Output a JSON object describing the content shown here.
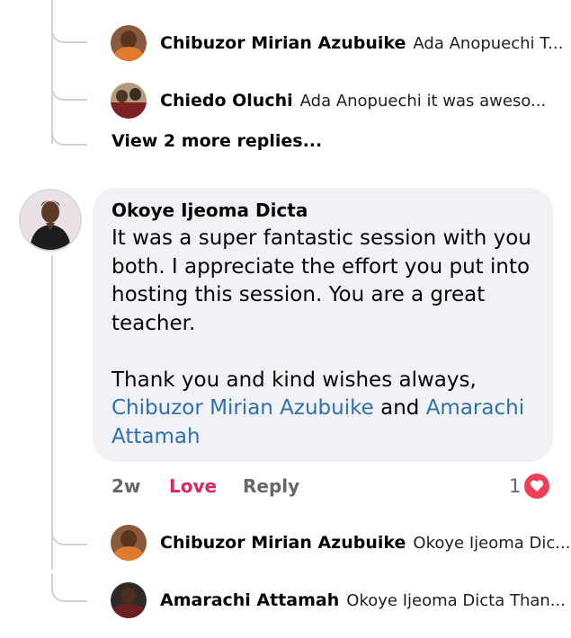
{
  "top_replies": [
    {
      "name": "Chibuzor Mirian Azubuike",
      "preview": "Ada Anopuechi T..."
    },
    {
      "name": "Chiedo Oluchi",
      "preview": "Ada Anopuechi it was aweso..."
    }
  ],
  "view_more": "View 2 more replies...",
  "comment": {
    "author": "Okoye Ijeoma Dicta",
    "paragraph1": "It was a super fantastic session with you both. I appreciate the effort you put into hosting this session. You are a great teacher.",
    "paragraph2": "Thank you and kind wishes always,",
    "mention1": "Chibuzor Mirian Azubuike",
    "conjunction": "and",
    "mention2": "Amarachi Attamah",
    "time": "2w",
    "reaction_label": "Love",
    "reply_label": "Reply",
    "reaction_count": "1",
    "reaction_icon": "heart-icon"
  },
  "bottom_replies": [
    {
      "name": "Chibuzor Mirian Azubuike",
      "preview": "Okoye Ijeoma Dic..."
    },
    {
      "name": "Amarachi Attamah",
      "preview": "Okoye Ijeoma Dicta Than..."
    }
  ],
  "colors": {
    "link": "#2f6fb0",
    "love": "#e0245e",
    "bubble": "#f0f2f5",
    "heart": "#f33e58"
  }
}
